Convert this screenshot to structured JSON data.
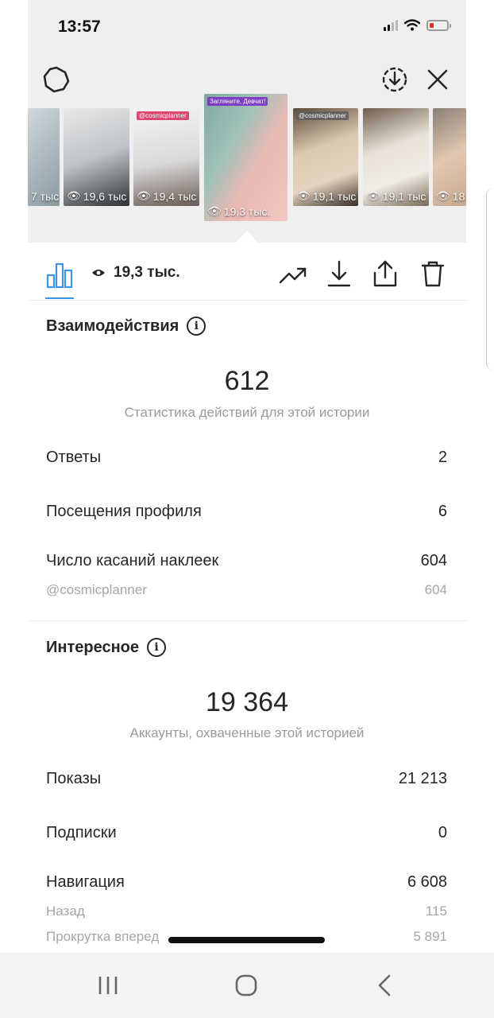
{
  "status_bar": {
    "time": "13:57",
    "battery_level": 0.25,
    "battery_color": "#e0302b",
    "icons": [
      "signal-icon",
      "wifi-icon",
      "battery-icon"
    ]
  },
  "top_actions": {
    "left_icon": "settings-gear-icon",
    "right_icons": [
      "download-circle-icon",
      "close-icon"
    ]
  },
  "thumbnails": [
    {
      "views": "7 тыс",
      "tag": "",
      "selected": false
    },
    {
      "views": "19,6 тыс",
      "tag": "",
      "selected": false
    },
    {
      "views": "19,4 тыс",
      "tag": "@cosmicplanner",
      "selected": false
    },
    {
      "views": "19,3 тыс.",
      "tag": "Загляните, Девчат!",
      "selected": true
    },
    {
      "views": "19,1 тыс",
      "tag": "@cosmicplanner",
      "selected": false
    },
    {
      "views": "19,1 тыс",
      "tag": "",
      "selected": false
    },
    {
      "views": "18",
      "tag": "",
      "selected": false
    }
  ],
  "toolbar": {
    "views": "19,3 тыс.",
    "accent_color": "#3897f0",
    "icons": [
      "bar-chart-icon",
      "eye-icon",
      "trending-icon",
      "download-icon",
      "share-icon",
      "trash-icon"
    ]
  },
  "interactions": {
    "title": "Взаимодействия",
    "total": "612",
    "caption": "Статистика действий для этой истории",
    "rows": [
      {
        "label": "Ответы",
        "value": "2"
      },
      {
        "label": "Посещения профиля",
        "value": "6"
      },
      {
        "label": "Число касаний наклеек",
        "value": "604"
      }
    ],
    "sub_rows": [
      {
        "label": "@cosmicplanner",
        "value": "604"
      }
    ]
  },
  "discovery": {
    "title": "Интересное",
    "total": "19 364",
    "caption": "Аккаунты, охваченные этой историей",
    "rows": [
      {
        "label": "Показы",
        "value": "21 213"
      },
      {
        "label": "Подписки",
        "value": "0"
      },
      {
        "label": "Навигация",
        "value": "6 608"
      }
    ],
    "sub_rows": [
      {
        "label": "Назад",
        "value": "115"
      },
      {
        "label": "Прокрутка вперед",
        "value": "5 891"
      }
    ]
  },
  "navbar": {
    "icons": [
      "recent-apps-icon",
      "home-icon",
      "back-icon"
    ]
  }
}
